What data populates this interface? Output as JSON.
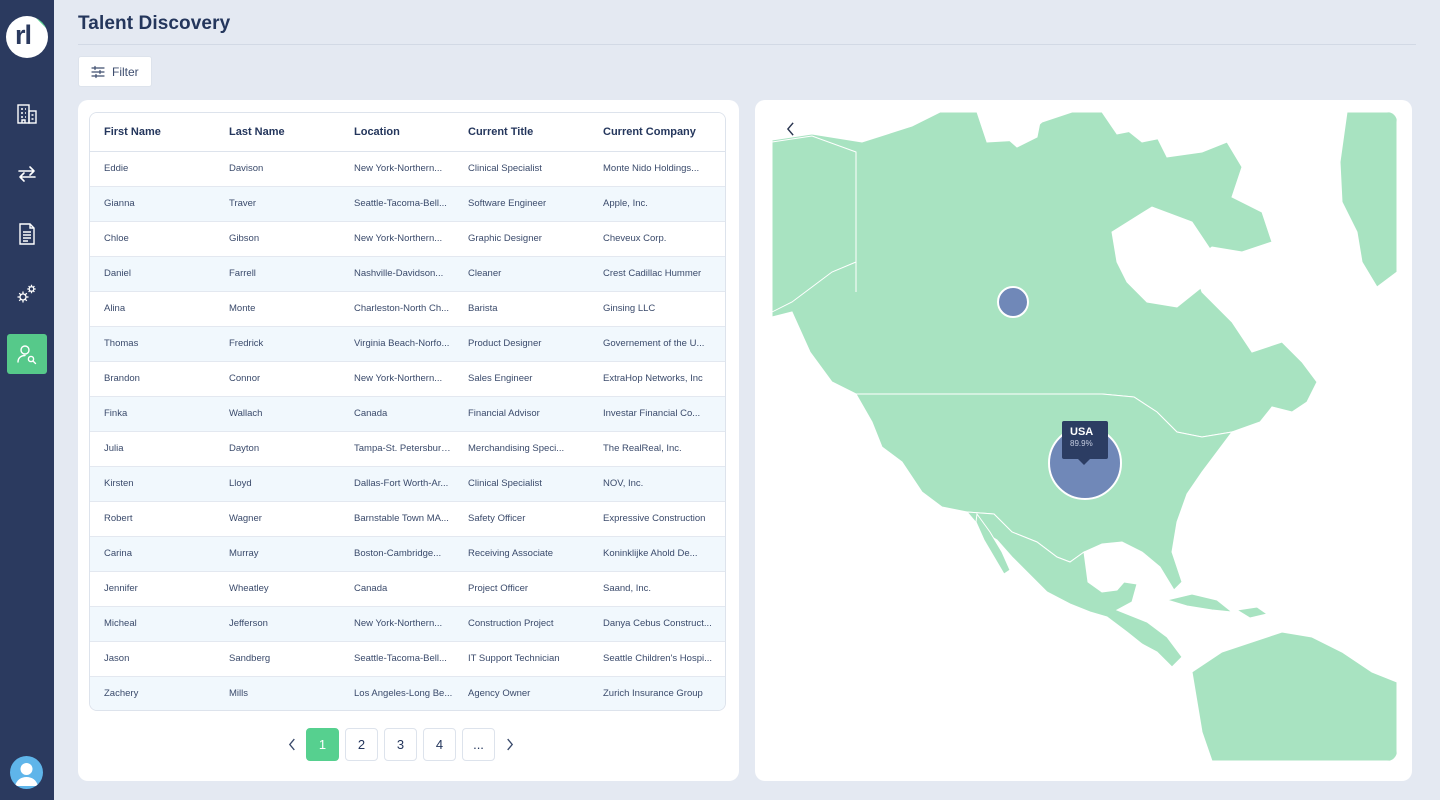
{
  "app": {
    "logo_text": "rl"
  },
  "sidebar": {
    "items": [
      {
        "name": "buildings",
        "icon": "building-icon",
        "active": false
      },
      {
        "name": "transfers",
        "icon": "swap-arrows-icon",
        "active": false
      },
      {
        "name": "documents",
        "icon": "document-icon",
        "active": false
      },
      {
        "name": "settings",
        "icon": "gears-icon",
        "active": false
      },
      {
        "name": "talent-discovery",
        "icon": "user-search-icon",
        "active": true
      }
    ],
    "avatar_icon": "user-avatar-icon"
  },
  "header": {
    "title": "Talent Discovery"
  },
  "toolbar": {
    "filter_label": "Filter",
    "filter_icon": "sliders-icon"
  },
  "table": {
    "columns": [
      "First Name",
      "Last Name",
      "Location",
      "Current Title",
      "Current Company"
    ],
    "rows": [
      [
        "Eddie",
        "Davison",
        "New York-Northern...",
        "Clinical Specialist",
        "Monte Nido Holdings..."
      ],
      [
        "Gianna",
        "Traver",
        "Seattle-Tacoma-Bell...",
        "Software Engineer",
        "Apple, Inc."
      ],
      [
        "Chloe",
        "Gibson",
        "New York-Northern...",
        "Graphic Designer",
        "Cheveux Corp."
      ],
      [
        "Daniel",
        "Farrell",
        "Nashville-Davidson...",
        "Cleaner",
        "Crest Cadillac Hummer"
      ],
      [
        "Alina",
        "Monte",
        "Charleston-North Ch...",
        "Barista",
        "Ginsing LLC"
      ],
      [
        "Thomas",
        "Fredrick",
        "Virginia Beach-Norfo...",
        "Product Designer",
        "Governement of the U..."
      ],
      [
        "Brandon",
        "Connor",
        "New York-Northern...",
        "Sales Engineer",
        "ExtraHop Networks, Inc"
      ],
      [
        "Finka",
        "Wallach",
        "Canada",
        "Financial Advisor",
        "Investar Financial Co..."
      ],
      [
        "Julia",
        "Dayton",
        "Tampa-St. Petersburg...",
        "Merchandising Speci...",
        "The RealReal, Inc."
      ],
      [
        "Kirsten",
        "Lloyd",
        "Dallas-Fort Worth-Ar...",
        "Clinical Specialist",
        "NOV, Inc."
      ],
      [
        "Robert",
        "Wagner",
        "Barnstable Town MA...",
        "Safety Officer",
        "Expressive Construction"
      ],
      [
        "Carina",
        "Murray",
        "Boston-Cambridge...",
        "Receiving Associate",
        "Koninklijke Ahold De..."
      ],
      [
        "Jennifer",
        "Wheatley",
        "Canada",
        "Project Officer",
        "Saand, Inc."
      ],
      [
        "Micheal",
        "Jefferson",
        "New York-Northern...",
        "Construction Project",
        "Danya Cebus Construct..."
      ],
      [
        "Jason",
        "Sandberg",
        "Seattle-Tacoma-Bell...",
        "IT Support Technician",
        "Seattle Children's Hospi..."
      ],
      [
        "Zachery",
        "Mills",
        "Los Angeles-Long Be...",
        "Agency Owner",
        "Zurich Insurance Group"
      ]
    ]
  },
  "pagination": {
    "prev_icon": "chevron-left-icon",
    "next_icon": "chevron-right-icon",
    "pages": [
      "1",
      "2",
      "3",
      "4",
      "..."
    ],
    "current": "1"
  },
  "map": {
    "back_icon": "chevron-left-icon",
    "tooltip": {
      "country": "USA",
      "percent": "89.9%"
    },
    "colors": {
      "land": "#a8e3c1",
      "bubble": "#7088b8",
      "tooltip": "#2c3d63"
    }
  }
}
